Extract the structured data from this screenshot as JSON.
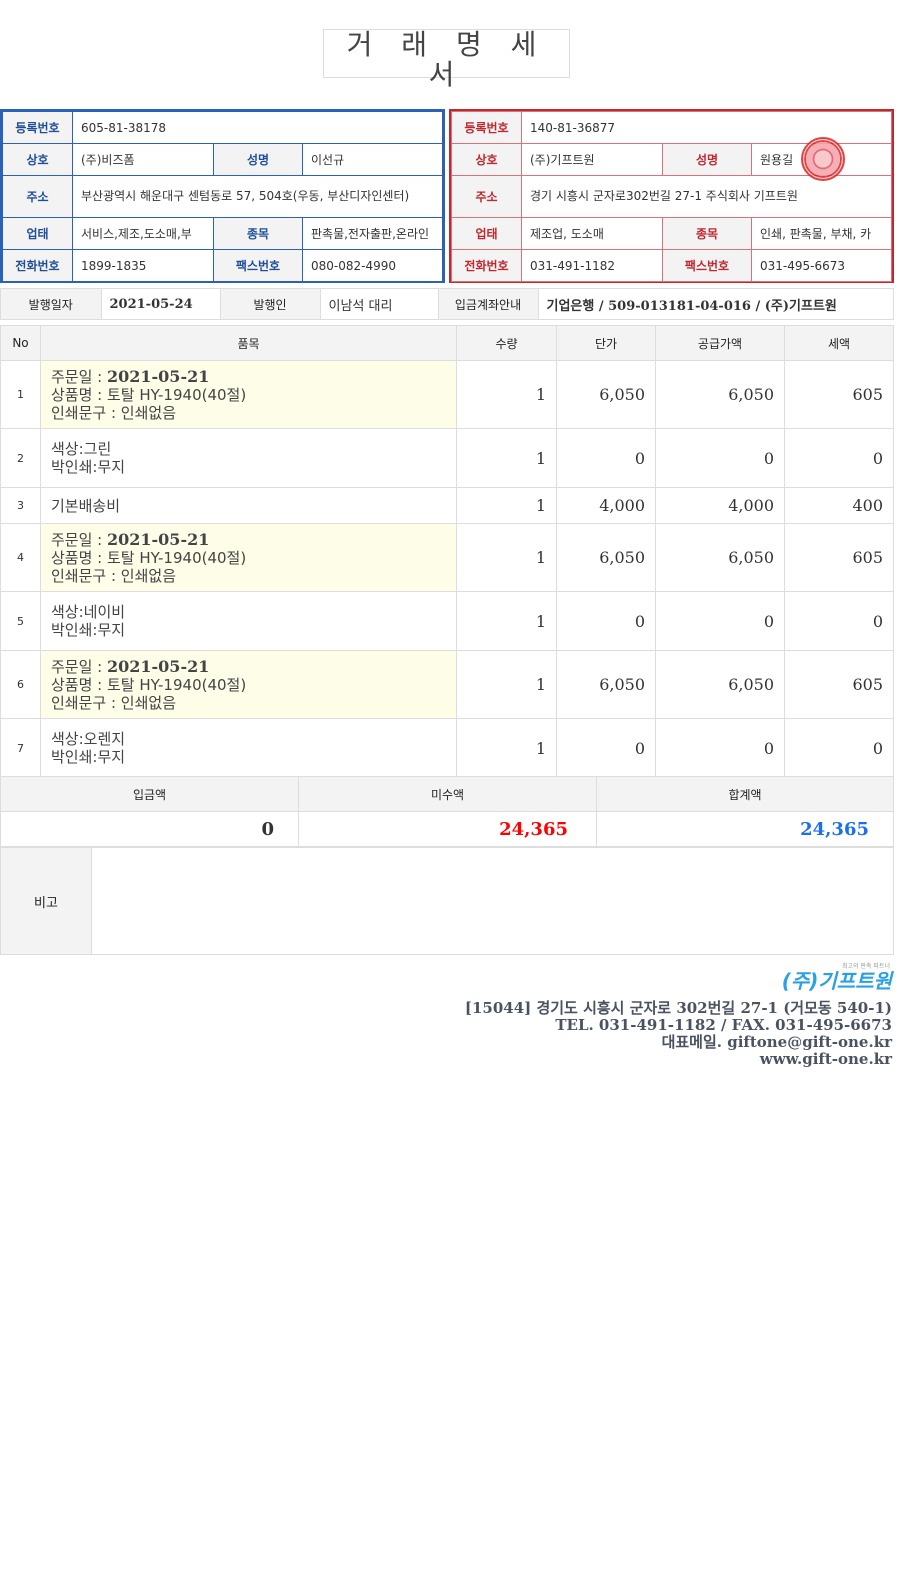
{
  "title": "거 래 명 세 서",
  "buyer": {
    "reg_label": "등록번호",
    "reg_value": "605-81-38178",
    "company_label": "상호",
    "company_value": "(주)비즈폼",
    "ceo_label": "성명",
    "ceo_value": "이선규",
    "address_label": "주소",
    "address_value": "부산광역시 해운대구 센텀동로 57, 504호(우동, 부산디자인센터)",
    "biz_type_label": "업태",
    "biz_type_value": "서비스,제조,도소매,부",
    "biz_item_label": "종목",
    "biz_item_value": "판촉물,전자출판,온라인",
    "phone_label": "전화번호",
    "phone_value": "1899-1835",
    "fax_label": "팩스번호",
    "fax_value": "080-082-4990"
  },
  "seller": {
    "reg_label": "등록번호",
    "reg_value": "140-81-36877",
    "company_label": "상호",
    "company_value": "(주)기프트원",
    "ceo_label": "성명",
    "ceo_value": "원용길",
    "address_label": "주소",
    "address_value": "경기 시흥시 군자로302번길 27-1 주식회사 기프트원",
    "biz_type_label": "업태",
    "biz_type_value": "제조업, 도소매",
    "biz_item_label": "종목",
    "biz_item_value": "인쇄, 판촉물, 부채, 카",
    "phone_label": "전화번호",
    "phone_value": "031-491-1182",
    "fax_label": "팩스번호",
    "fax_value": "031-495-6673"
  },
  "info": {
    "issue_date_label": "발행일자",
    "issue_date": "2021-05-24",
    "issuer_label": "발행인",
    "issuer": "이남석 대리",
    "account_label": "입금계좌안내",
    "account": "기업은행 / 509-013181-04-016 / (주)기프트원"
  },
  "items_header": {
    "no": "No",
    "item": "품목",
    "qty": "수량",
    "unit_price": "단가",
    "supply": "공급가액",
    "tax": "세액"
  },
  "items": [
    {
      "no": "1",
      "lines": [
        {
          "k": "주문일 : ",
          "b": "2021-05-21"
        },
        {
          "k": "상품명 : 토탈 HY-1940(40절)"
        },
        {
          "k": "인쇄문구 : 인쇄없음"
        }
      ],
      "qty": "1",
      "unit_price": "6,050",
      "supply": "6,050",
      "tax": "605"
    },
    {
      "no": "2",
      "lines": [
        {
          "k": "색상:그린"
        },
        {
          "k": "박인쇄:무지"
        }
      ],
      "qty": "1",
      "unit_price": "0",
      "supply": "0",
      "tax": "0"
    },
    {
      "no": "3",
      "lines": [
        {
          "k": "기본배송비"
        }
      ],
      "qty": "1",
      "unit_price": "4,000",
      "supply": "4,000",
      "tax": "400"
    },
    {
      "no": "4",
      "lines": [
        {
          "k": "주문일 : ",
          "b": "2021-05-21"
        },
        {
          "k": "상품명 : 토탈 HY-1940(40절)"
        },
        {
          "k": "인쇄문구 : 인쇄없음"
        }
      ],
      "qty": "1",
      "unit_price": "6,050",
      "supply": "6,050",
      "tax": "605"
    },
    {
      "no": "5",
      "lines": [
        {
          "k": "색상:네이비"
        },
        {
          "k": "박인쇄:무지"
        }
      ],
      "qty": "1",
      "unit_price": "0",
      "supply": "0",
      "tax": "0"
    },
    {
      "no": "6",
      "lines": [
        {
          "k": "주문일 : ",
          "b": "2021-05-21"
        },
        {
          "k": "상품명 : 토탈 HY-1940(40절)"
        },
        {
          "k": "인쇄문구 : 인쇄없음"
        }
      ],
      "qty": "1",
      "unit_price": "6,050",
      "supply": "6,050",
      "tax": "605"
    },
    {
      "no": "7",
      "lines": [
        {
          "k": "색상:오렌지"
        },
        {
          "k": "박인쇄:무지"
        }
      ],
      "qty": "1",
      "unit_price": "0",
      "supply": "0",
      "tax": "0"
    }
  ],
  "totals": {
    "paid_label": "입금액",
    "paid": "0",
    "unpaid_label": "미수액",
    "unpaid": "24,365",
    "total_label": "합계액",
    "total": "24,365"
  },
  "remarks": {
    "label": "비고",
    "value": ""
  },
  "footer": {
    "logo_text": "(주)기프트원",
    "address": "[15044] 경기도 시흥시 군자로 302번길 27-1 (거모동 540-1)",
    "tel_fax": "TEL. 031-491-1182 / FAX. 031-495-6673",
    "email": "대표메일. giftone@gift-one.kr",
    "website": "www.gift-one.kr"
  },
  "colors": {
    "buyer_border": "#2a62b8",
    "seller_border": "#c0282e",
    "unpaid": "#ff0000",
    "total": "#1a6ef0",
    "highlight_row": "#fdfde8"
  }
}
